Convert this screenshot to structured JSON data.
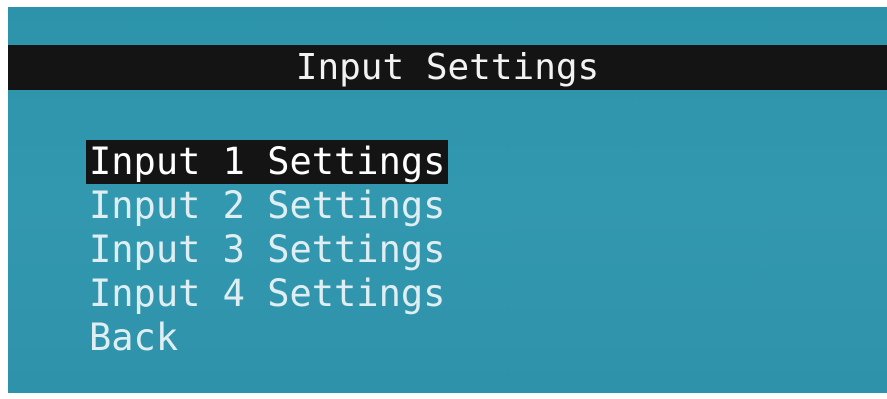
{
  "screen": {
    "title": "Input Settings"
  },
  "menu": {
    "items": [
      {
        "label": "Input 1 Settings",
        "selected": true
      },
      {
        "label": "Input 2 Settings",
        "selected": false
      },
      {
        "label": "Input 3 Settings",
        "selected": false
      },
      {
        "label": "Input 4 Settings",
        "selected": false
      },
      {
        "label": "Back",
        "selected": false
      }
    ]
  },
  "colors": {
    "background": "#2f95ad",
    "bar": "#141414",
    "text": "#dfeef2"
  }
}
